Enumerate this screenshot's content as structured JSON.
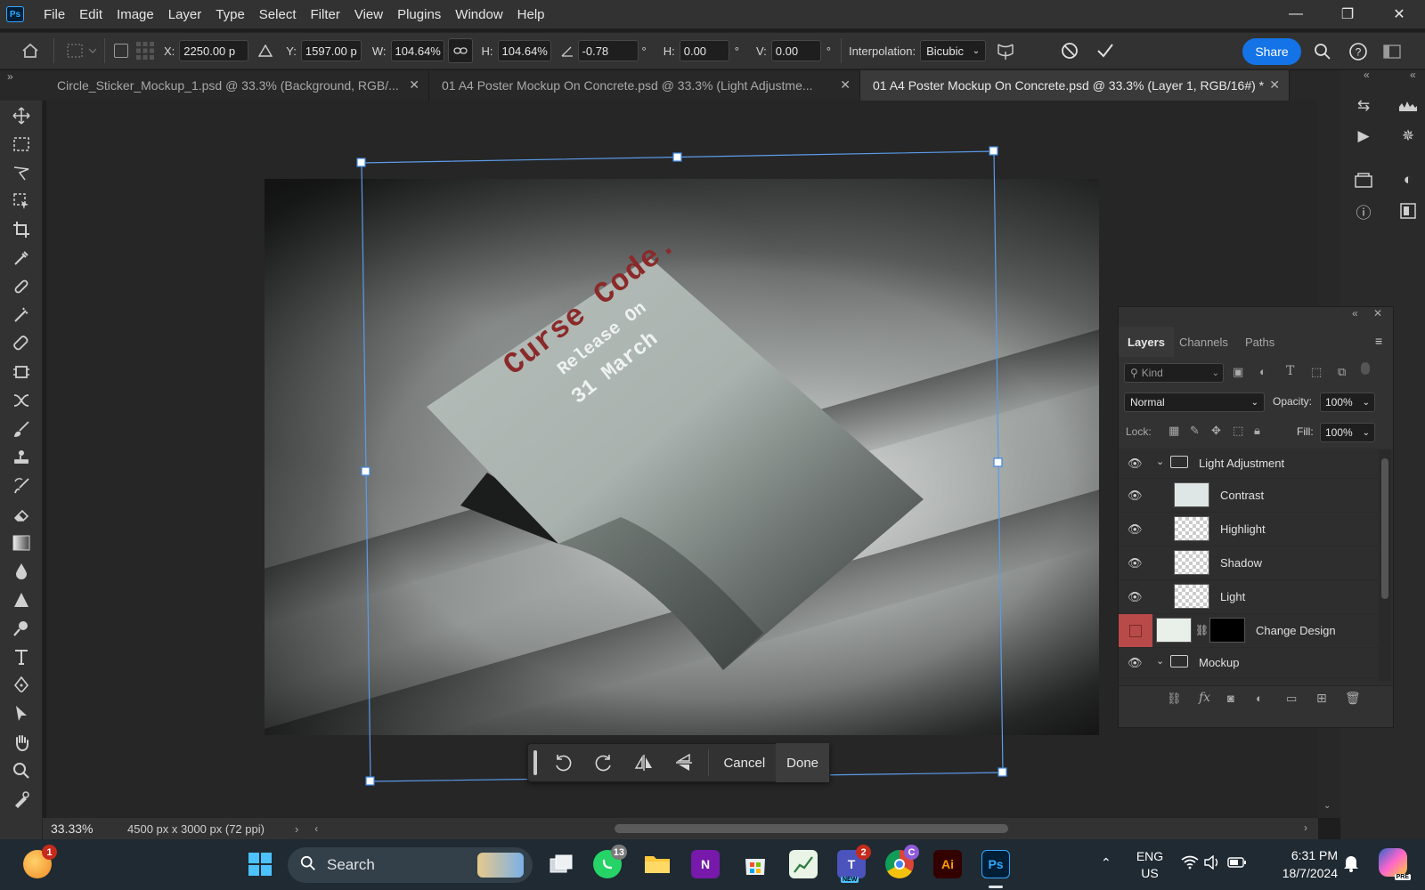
{
  "app": {
    "logo": "Ps",
    "menu": [
      "File",
      "Edit",
      "Image",
      "Layer",
      "Type",
      "Select",
      "Filter",
      "View",
      "Plugins",
      "Window",
      "Help"
    ]
  },
  "window_controls": {
    "minimize": "—",
    "restore": "❐",
    "close": "✕"
  },
  "options": {
    "x_label": "X:",
    "x_value": "2250.00 p",
    "y_label": "Y:",
    "y_value": "1597.00 p",
    "w_label": "W:",
    "w_value": "104.64%",
    "h_label": "H:",
    "h_value": "104.64%",
    "angle_value": "-0.78",
    "angle_unit": "°",
    "hskew_label": "H:",
    "hskew_value": "0.00",
    "vskew_label": "V:",
    "vskew_value": "0.00",
    "interpolation_label": "Interpolation:",
    "interpolation_value": "Bicubic",
    "share_label": "Share"
  },
  "tabs": [
    {
      "title": "Circle_Sticker_Mockup_1.psd @ 33.3% (Background, RGB/...",
      "active": false
    },
    {
      "title": "01 A4 Poster Mockup On Concrete.psd @ 33.3% (Light Adjustme...",
      "active": false
    },
    {
      "title": "01 A4 Poster Mockup On Concrete.psd @ 33.3% (Layer 1, RGB/16#) *",
      "active": true
    }
  ],
  "poster": {
    "title": "Curse Code.",
    "line1": "Release On",
    "line2": "31 March"
  },
  "contextual_bar": {
    "cancel_label": "Cancel",
    "done_label": "Done"
  },
  "layers_panel": {
    "tabs": [
      "Layers",
      "Channels",
      "Paths"
    ],
    "kind_placeholder": "Kind",
    "blend_mode": "Normal",
    "opacity_label": "Opacity:",
    "opacity_value": "100%",
    "lock_label": "Lock:",
    "fill_label": "Fill:",
    "fill_value": "100%",
    "layers": [
      {
        "name": "Light Adjustment",
        "type": "group",
        "visible": true
      },
      {
        "name": "Contrast",
        "type": "layer",
        "visible": true
      },
      {
        "name": "Highlight",
        "type": "layer",
        "visible": true
      },
      {
        "name": "Shadow",
        "type": "layer",
        "visible": true
      },
      {
        "name": "Light",
        "type": "layer",
        "visible": true
      },
      {
        "name": "Change Design",
        "type": "smart-object",
        "visible": false
      },
      {
        "name": "Mockup",
        "type": "group",
        "visible": true
      }
    ]
  },
  "status": {
    "zoom": "33.33%",
    "doc_info": "4500 px x 3000 px (72 ppi)"
  },
  "taskbar": {
    "search_label": "Search",
    "widget_badge": "1",
    "whatsapp_badge": "13",
    "teams_badge": "2",
    "chrome_badge": "C",
    "teams_new": "NEW",
    "lang_line1": "ENG",
    "lang_line2": "US",
    "time": "6:31 PM",
    "date": "18/7/2024",
    "pre_label": "PRE"
  }
}
